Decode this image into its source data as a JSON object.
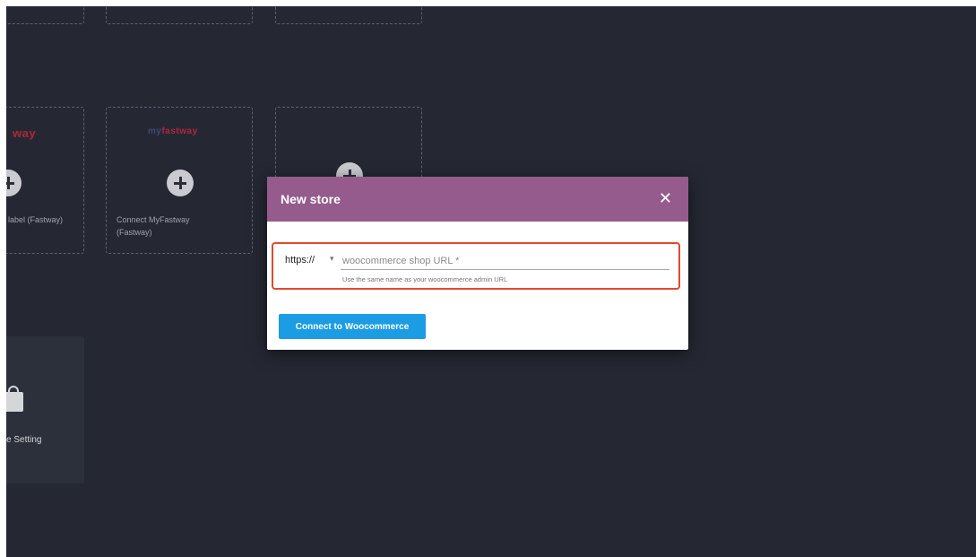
{
  "modal": {
    "title": "New store",
    "close_icon": "close-icon",
    "protocol": {
      "selected": "https://",
      "icon": "caret-down-icon"
    },
    "url_input": {
      "value": "",
      "placeholder": "woocommerce shop URL *"
    },
    "helper_text": "Use the same name as your woocommerce admin URL",
    "connect_label": "Connect to Woocommerce"
  },
  "background": {
    "cards": [
      {
        "logo": "way",
        "label": "label (Fastway)",
        "icon": "plus-circle-icon"
      },
      {
        "logo": "myfastway",
        "label": "Connect MyFastway (Fastway)",
        "icon": "plus-circle-icon"
      },
      {
        "logo": "",
        "label": "",
        "icon": "plus-circle-icon"
      }
    ],
    "setting_card": {
      "label": "e Setting",
      "icon": "shopping-bag-icon"
    }
  },
  "colors": {
    "background": "#252833",
    "modal_header": "#955b8c",
    "button": "#1c9ce3",
    "highlight": "#e2492f",
    "logo_red": "#b3263b",
    "logo_blue": "#3a4a7a"
  }
}
